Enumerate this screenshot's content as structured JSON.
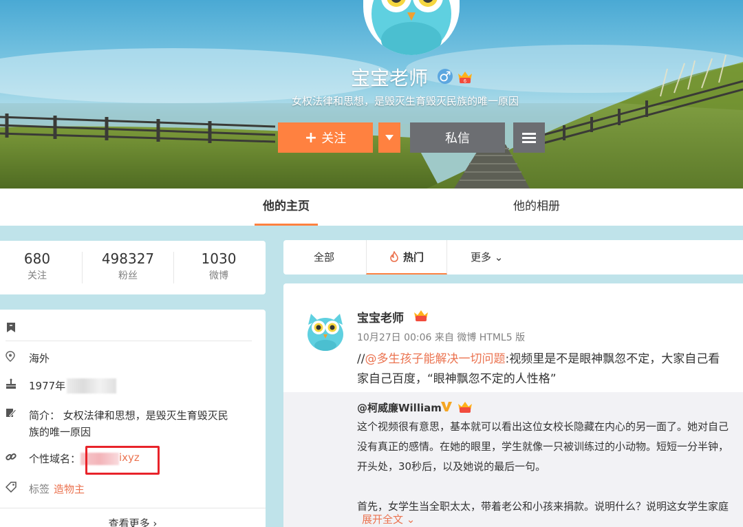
{
  "profile": {
    "name": "宝宝老师",
    "gender_symbol": "♂",
    "bio_line": "女权法律和思想，是毁灭生育毁灭民族的唯一原因"
  },
  "actions": {
    "follow_label": "关注",
    "follow_plus": "+",
    "message_label": "私信"
  },
  "tabs": {
    "home": "他的主页",
    "album": "他的相册"
  },
  "stats": [
    {
      "value": "680",
      "label": "关注"
    },
    {
      "value": "498327",
      "label": "粉丝"
    },
    {
      "value": "1030",
      "label": "微博"
    }
  ],
  "info": {
    "location": "海外",
    "birthday_visible": "1977年",
    "intro_label": "简介：",
    "intro_line1": "女权法律和思想，是毁灭生育毁灭民",
    "intro_line2": "族的唯一原因",
    "domain_label": "个性域名：",
    "domain_visible": "ixyz",
    "tag_label": "标签",
    "tag_value": "造物主",
    "see_more": "查看更多 ›"
  },
  "filter": {
    "all": "全部",
    "hot": "热门",
    "more": "更多 ⌄"
  },
  "post": {
    "author": "宝宝老师",
    "meta": "10月27日 00:06 来自 微博 HTML5 版",
    "prefix": "//",
    "mention": "@多生孩子能解决一切问题",
    "text_rest": ":视频里是不是眼神飘忽不定，大家自己看",
    "line2": "家自己百度，“眼神飘忽不定的人性格”",
    "repost": {
      "author": "@柯威廉William",
      "lines": [
        "这个视频很有意思，基本就可以看出这位女校长隐藏在内心的另一面了。她对自己",
        "没有真正的感情。在她的眼里，学生就像一只被训练过的小动物。短短一分半钟，",
        "开头处，30秒后，以及她说的最后一句。",
        "",
        "首先，女学生当全职太太，带着老公和小孩来捐款。说明什么？说明这女学生家庭"
      ],
      "expand": "展开全文 ⌄"
    }
  },
  "colors": {
    "accent_orange": "#ff8140",
    "link_orange": "#eb7350",
    "button_gray": "#6c6e72",
    "highlight_red": "#e8232a"
  },
  "icons": [
    "gender-male-icon",
    "vip-crown-icon",
    "caret-down-icon",
    "hamburger-icon",
    "fire-icon",
    "verified-v-icon",
    "bookmark-icon",
    "location-icon",
    "cake-icon",
    "edit-icon",
    "link-icon",
    "tag-icon"
  ]
}
